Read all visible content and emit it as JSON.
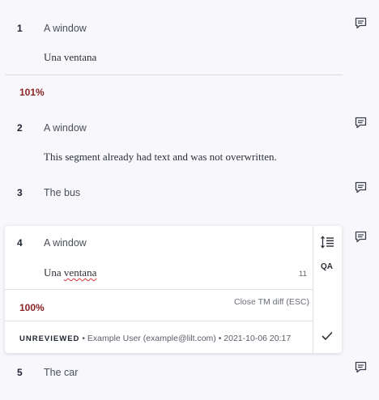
{
  "segments": [
    {
      "number": "1",
      "source": "A window",
      "target": "Una ventana"
    },
    {
      "match": "101%"
    },
    {
      "number": "2",
      "source": "A window",
      "target": "This segment already had text and was not overwritten."
    },
    {
      "number": "3",
      "source": "The bus"
    },
    {
      "number": "5",
      "source": "The car"
    }
  ],
  "active": {
    "number": "4",
    "source": "A window",
    "target_word1": "Una",
    "target_word2": "ventana",
    "char_count": "11",
    "match": "100%",
    "close_diff": "Close TM diff (ESC)",
    "status_badge": "UNREVIEWED",
    "status_detail": " • Example User (example@lilt.com) • 2021-10-06 20:17",
    "qa_label": "QA"
  },
  "icons": {
    "comment": "comment-icon",
    "sort_lines": "line-height-icon",
    "confirm": "checkmark-icon"
  },
  "colors": {
    "match_text": "#8a2424",
    "background": "#f8f8fc",
    "misspelling": "#dd3333"
  }
}
